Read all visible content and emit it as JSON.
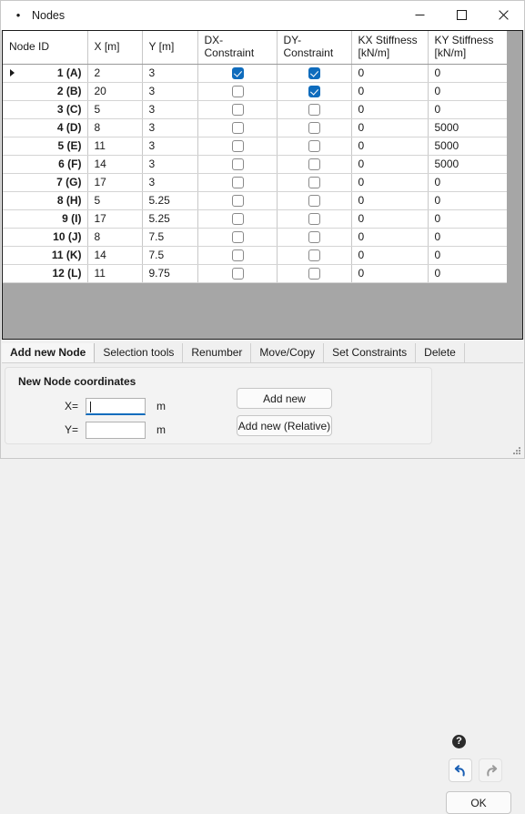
{
  "window": {
    "title": "Nodes",
    "bullet": "•",
    "controls": {
      "minimize": "minimize-icon",
      "maximize": "maximize-icon",
      "close": "close-icon"
    }
  },
  "table": {
    "columns": [
      {
        "label": "Node ID",
        "sub": ""
      },
      {
        "label": "X [m]",
        "sub": ""
      },
      {
        "label": "Y [m]",
        "sub": ""
      },
      {
        "label": "DX-Constraint",
        "sub": ""
      },
      {
        "label": "DY-Constraint",
        "sub": ""
      },
      {
        "label": "KX Stiffness",
        "sub": "[kN/m]"
      },
      {
        "label": "KY Stiffness",
        "sub": "[kN/m]"
      }
    ],
    "selected_cell": {
      "row": 0,
      "column": 1
    },
    "rows": [
      {
        "id": "1 (A)",
        "x": "2",
        "y": "3",
        "dx": true,
        "dy": true,
        "kx": "0",
        "ky": "0",
        "current": true
      },
      {
        "id": "2 (B)",
        "x": "20",
        "y": "3",
        "dx": false,
        "dy": true,
        "kx": "0",
        "ky": "0",
        "current": false
      },
      {
        "id": "3 (C)",
        "x": "5",
        "y": "3",
        "dx": false,
        "dy": false,
        "kx": "0",
        "ky": "0",
        "current": false
      },
      {
        "id": "4 (D)",
        "x": "8",
        "y": "3",
        "dx": false,
        "dy": false,
        "kx": "0",
        "ky": "5000",
        "current": false
      },
      {
        "id": "5 (E)",
        "x": "11",
        "y": "3",
        "dx": false,
        "dy": false,
        "kx": "0",
        "ky": "5000",
        "current": false
      },
      {
        "id": "6 (F)",
        "x": "14",
        "y": "3",
        "dx": false,
        "dy": false,
        "kx": "0",
        "ky": "5000",
        "current": false
      },
      {
        "id": "7 (G)",
        "x": "17",
        "y": "3",
        "dx": false,
        "dy": false,
        "kx": "0",
        "ky": "0",
        "current": false
      },
      {
        "id": "8 (H)",
        "x": "5",
        "y": "5.25",
        "dx": false,
        "dy": false,
        "kx": "0",
        "ky": "0",
        "current": false
      },
      {
        "id": "9 (I)",
        "x": "17",
        "y": "5.25",
        "dx": false,
        "dy": false,
        "kx": "0",
        "ky": "0",
        "current": false
      },
      {
        "id": "10 (J)",
        "x": "8",
        "y": "7.5",
        "dx": false,
        "dy": false,
        "kx": "0",
        "ky": "0",
        "current": false
      },
      {
        "id": "11 (K)",
        "x": "14",
        "y": "7.5",
        "dx": false,
        "dy": false,
        "kx": "0",
        "ky": "0",
        "current": false
      },
      {
        "id": "12 (L)",
        "x": "11",
        "y": "9.75",
        "dx": false,
        "dy": false,
        "kx": "0",
        "ky": "0",
        "current": false
      }
    ]
  },
  "tabs": [
    {
      "label": "Add new Node",
      "active": true
    },
    {
      "label": "Selection tools",
      "active": false
    },
    {
      "label": "Renumber",
      "active": false
    },
    {
      "label": "Move/Copy",
      "active": false
    },
    {
      "label": "Set Constraints",
      "active": false
    },
    {
      "label": "Delete",
      "active": false
    }
  ],
  "panel": {
    "title": "New Node coordinates",
    "fields": [
      {
        "label": "X=",
        "value": "",
        "placeholder": "",
        "unit": "m",
        "focused": true
      },
      {
        "label": "Y=",
        "value": "",
        "placeholder": "",
        "unit": "m",
        "focused": false
      }
    ],
    "buttons": {
      "add_new": "Add new",
      "add_new_relative": "Add new (Relative)"
    }
  },
  "actions": {
    "help": "?",
    "undo": "undo-icon",
    "redo": "redo-icon",
    "ok": "OK"
  },
  "colors": {
    "accent": "#0f6cbd",
    "selection": "#0f6cbd",
    "grid_border": "#c8c8c8",
    "table_background": "#a6a6a6",
    "window_background": "#f0f0f0"
  }
}
